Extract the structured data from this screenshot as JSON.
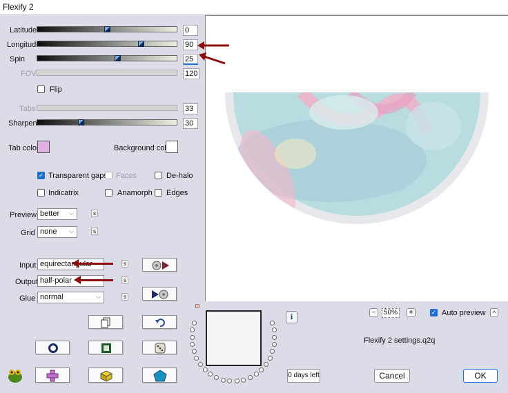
{
  "window": {
    "title": "Flexify 2"
  },
  "colors": {
    "arrow": "#8b0d0d",
    "tab_color": "#e0b0e0",
    "background_color": "#ffffff",
    "accent": "#1a6fd0"
  },
  "sliders": {
    "latitude": {
      "label": "Latitude",
      "value": "0",
      "level": 0.5
    },
    "longitude": {
      "label": "Longitude",
      "value": "90",
      "level": 0.75
    },
    "spin": {
      "label": "Spin",
      "value": "25",
      "level": 0.57
    },
    "fov": {
      "label": "FOV",
      "value": "120",
      "level": null
    },
    "tabs": {
      "label": "Tabs",
      "value": "33",
      "level": null
    },
    "sharpen": {
      "label": "Sharpen",
      "value": "30",
      "level": 0.3
    }
  },
  "flip": {
    "label": "Flip",
    "checked": false
  },
  "tab_color": {
    "label": "Tab color"
  },
  "background_color": {
    "label": "Background color"
  },
  "checks": {
    "transparent_gaps": {
      "label": "Transparent gaps",
      "checked": true
    },
    "faces": {
      "label": "Faces",
      "checked": false
    },
    "de_halo": {
      "label": "De-halo",
      "checked": false
    },
    "indicatrix": {
      "label": "Indicatrix",
      "checked": false
    },
    "anamorph": {
      "label": "Anamorph",
      "checked": false
    },
    "edges": {
      "label": "Edges",
      "checked": false
    }
  },
  "preview": {
    "label": "Preview",
    "value": "better"
  },
  "grid": {
    "label": "Grid",
    "value": "none"
  },
  "input": {
    "label": "Input",
    "value": "equirectangular"
  },
  "output": {
    "label": "Output",
    "value": "half-polar"
  },
  "glue": {
    "label": "Glue",
    "value": "normal"
  },
  "s_label": "s",
  "zoom": {
    "minus": "−",
    "value": "50%",
    "plus": "+"
  },
  "auto_preview": {
    "label": "Auto preview",
    "checked": true
  },
  "caret": "^",
  "settings_file": "Flexify 2 settings.q2q",
  "info_label": "i",
  "days_left": "0 days left",
  "cancel": "Cancel",
  "ok": "OK"
}
